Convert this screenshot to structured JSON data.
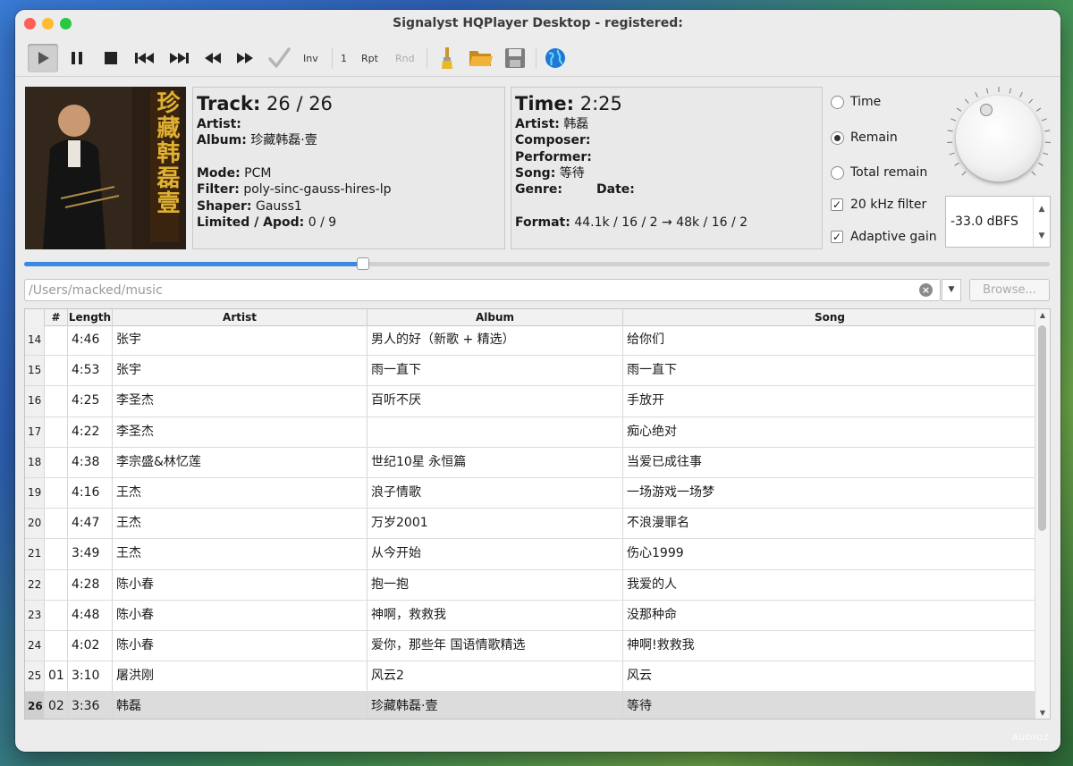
{
  "window": {
    "title": "Signalyst HQPlayer Desktop - registered:"
  },
  "toolbar": {
    "inv_label": "Inv",
    "one_label": "1",
    "rpt_label": "Rpt",
    "rnd_label": "Rnd",
    "icons": [
      "play-icon",
      "pause-icon",
      "stop-icon",
      "previous-track-icon",
      "next-track-icon",
      "rewind-icon",
      "fast-forward-icon",
      "checkmark-icon",
      "brush-icon",
      "folder-open-icon",
      "save-icon",
      "globe-icon"
    ]
  },
  "track_panel": {
    "track_label": "Track:",
    "track_value": "26 / 26",
    "artist_label": "Artist:",
    "artist_value": "",
    "album_label": "Album:",
    "album_value": "珍藏韩磊·壹",
    "mode_label": "Mode:",
    "mode_value": "PCM",
    "filter_label": "Filter:",
    "filter_value": "poly-sinc-gauss-hires-lp",
    "shaper_label": "Shaper:",
    "shaper_value": "Gauss1",
    "limited_label": "Limited / Apod:",
    "limited_value": "0 / 9"
  },
  "time_panel": {
    "time_label": "Time:",
    "time_value": "2:25",
    "artist_label": "Artist:",
    "artist_value": "韩磊",
    "composer_label": "Composer:",
    "performer_label": "Performer:",
    "song_label": "Song:",
    "song_value": "等待",
    "genre_label": "Genre:",
    "date_label": "Date:",
    "format_label": "Format:",
    "format_value": "44.1k / 16 / 2 → 48k / 16 / 2"
  },
  "options": {
    "time_radio": "Time",
    "remain_radio": "Remain",
    "total_remain_radio": "Total remain",
    "selected": "Remain",
    "filter_20k": "20 kHz filter",
    "adaptive_gain": "Adaptive gain",
    "volume": "-33.0 dBFS"
  },
  "progress": {
    "fraction": 0.33
  },
  "path": {
    "placeholder": "/Users/macked/music",
    "browse_label": "Browse..."
  },
  "table": {
    "headers": {
      "num": "#",
      "length": "Length",
      "artist": "Artist",
      "album": "Album",
      "song": "Song"
    },
    "rows": [
      {
        "idx": "14",
        "num": "",
        "length": "4:46",
        "artist": "张宇",
        "album": "男人的好（新歌 + 精选）",
        "song": "给你们"
      },
      {
        "idx": "15",
        "num": "",
        "length": "4:53",
        "artist": "张宇",
        "album": "雨一直下",
        "song": "雨一直下"
      },
      {
        "idx": "16",
        "num": "",
        "length": "4:25",
        "artist": "李圣杰",
        "album": "百听不厌",
        "song": "手放开"
      },
      {
        "idx": "17",
        "num": "",
        "length": "4:22",
        "artist": "李圣杰",
        "album": "",
        "song": "痴心绝对"
      },
      {
        "idx": "18",
        "num": "",
        "length": "4:38",
        "artist": "李宗盛&林忆莲",
        "album": "世纪10星 永恒篇",
        "song": "当爱已成往事"
      },
      {
        "idx": "19",
        "num": "",
        "length": "4:16",
        "artist": "王杰",
        "album": "浪子情歌",
        "song": "一场游戏一场梦"
      },
      {
        "idx": "20",
        "num": "",
        "length": "4:47",
        "artist": "王杰",
        "album": "万岁2001",
        "song": "不浪漫罪名"
      },
      {
        "idx": "21",
        "num": "",
        "length": "3:49",
        "artist": "王杰",
        "album": "从今开始",
        "song": "伤心1999"
      },
      {
        "idx": "22",
        "num": "",
        "length": "4:28",
        "artist": "陈小春",
        "album": "抱一抱",
        "song": "我爱的人"
      },
      {
        "idx": "23",
        "num": "",
        "length": "4:48",
        "artist": "陈小春",
        "album": "神啊，救救我",
        "song": "没那种命"
      },
      {
        "idx": "24",
        "num": "",
        "length": "4:02",
        "artist": "陈小春",
        "album": "爱你，那些年 国语情歌精选",
        "song": "神啊!救救我"
      },
      {
        "idx": "25",
        "num": "01",
        "length": "3:10",
        "artist": "屠洪刚",
        "album": "风云2",
        "song": "风云"
      },
      {
        "idx": "26",
        "num": "02",
        "length": "3:36",
        "artist": "韩磊",
        "album": "珍藏韩磊·壹",
        "song": "等待",
        "selected": true
      }
    ]
  },
  "watermark": "AUDIOZ",
  "album_art_text": "珍藏韩磊壹"
}
